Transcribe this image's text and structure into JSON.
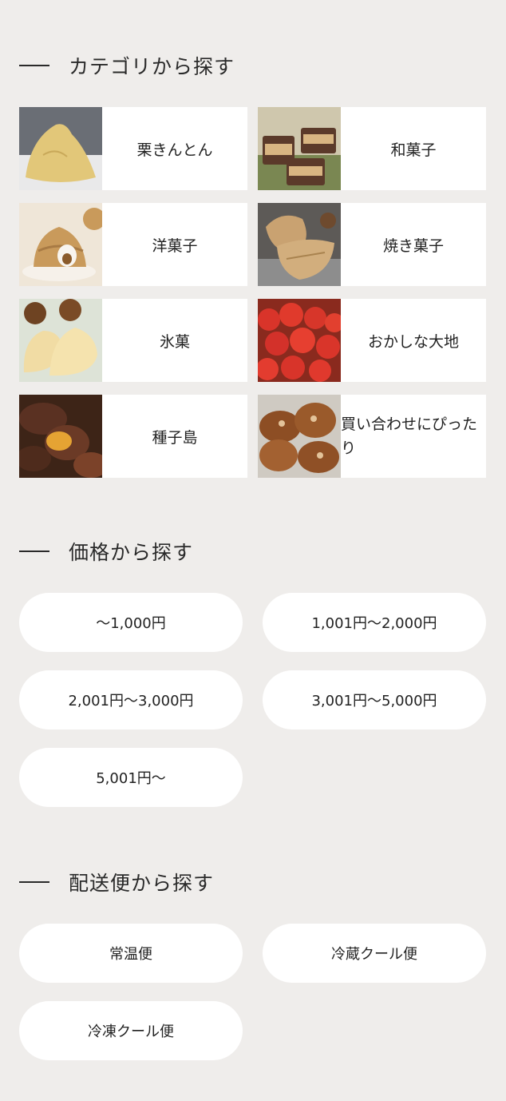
{
  "category_section": {
    "title": "カテゴリから探す",
    "items": [
      {
        "label": "栗きんとん",
        "icon": "chestnut-kinton-photo"
      },
      {
        "label": "和菓子",
        "icon": "wagashi-photo"
      },
      {
        "label": "洋菓子",
        "icon": "yogashi-photo"
      },
      {
        "label": "焼き菓子",
        "icon": "baked-sweets-photo"
      },
      {
        "label": "氷菓",
        "icon": "ice-sweets-photo"
      },
      {
        "label": "おかしな大地",
        "icon": "tomato-photo"
      },
      {
        "label": "種子島",
        "icon": "sweet-potato-photo"
      },
      {
        "label": "買い合わせにぴったり",
        "icon": "florentine-photo"
      }
    ]
  },
  "price_section": {
    "title": "価格から探す",
    "items": [
      "〜1,000円",
      "1,001円〜2,000円",
      "2,001円〜3,000円",
      "3,001円〜5,000円",
      "5,001円〜"
    ]
  },
  "delivery_section": {
    "title": "配送便から探す",
    "items": [
      "常温便",
      "冷蔵クール便",
      "冷凍クール便"
    ]
  }
}
